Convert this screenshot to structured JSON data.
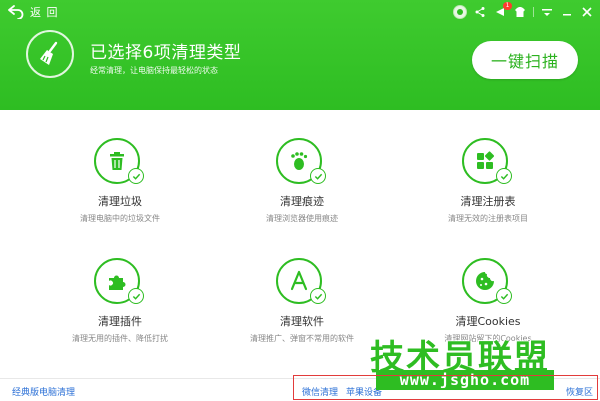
{
  "header": {
    "back_label": "返 回",
    "headline": "已选择6项清理类型",
    "subline": "经常清理，让电脑保持最轻松的状态",
    "scan_button": "一键扫描",
    "notification_count": "1"
  },
  "items": [
    {
      "title": "清理垃圾",
      "desc": "清理电脑中的垃圾文件",
      "icon": "trash-icon"
    },
    {
      "title": "清理痕迹",
      "desc": "清理浏览器使用痕迹",
      "icon": "footprint-icon"
    },
    {
      "title": "清理注册表",
      "desc": "清理无效的注册表项目",
      "icon": "registry-grid-icon"
    },
    {
      "title": "清理插件",
      "desc": "清理无用的插件、降低打扰",
      "icon": "puzzle-icon"
    },
    {
      "title": "清理软件",
      "desc": "清理推广、弹窗不常用的软件",
      "icon": "app-store-icon"
    },
    {
      "title": "清理Cookies",
      "desc": "清理网站留下的Cookies",
      "icon": "cookie-icon"
    }
  ],
  "footer": {
    "classic": "经典版电脑清理",
    "wechat": "微信清理",
    "apple": "苹果设备",
    "restore": "恢复区"
  },
  "watermark": {
    "brand": "技术员联盟",
    "url": "www.jsgho.com"
  },
  "colors": {
    "brand_green": "#2ebd22",
    "link_blue": "#2a6fd6",
    "highlight_red": "#e23b3b"
  }
}
